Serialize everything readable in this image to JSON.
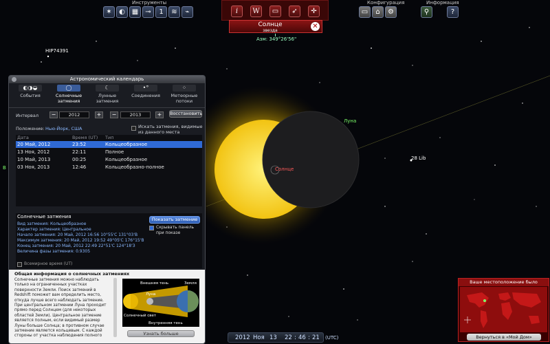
{
  "toolbar": {
    "tools_label": "Инструменты",
    "config_label": "Конфигурация",
    "info_label": "Информация",
    "tool_icons": [
      "constellation-icon",
      "planet-icon",
      "calendar-icon",
      "telescope-icon",
      "number-icon",
      "stats-icon",
      "satellite-icon"
    ],
    "center_icons": [
      {
        "name": "info-icon",
        "glyph": "i"
      },
      {
        "name": "wikipedia-icon",
        "glyph": "W"
      },
      {
        "name": "book-icon",
        "glyph": "▭"
      },
      {
        "name": "rocket-icon",
        "glyph": "➶"
      },
      {
        "name": "crosshair-icon",
        "glyph": "✛"
      }
    ],
    "config_icons": [
      "display-icon",
      "location-icon",
      "gear-icon"
    ],
    "help_icons": [
      {
        "name": "magnifier-icon",
        "glyph": "⚲"
      },
      {
        "name": "help-icon",
        "glyph": "?"
      }
    ]
  },
  "object_info": {
    "name": "Солнце",
    "type": "звезда",
    "azimuth": "Азм: 349°26'56\""
  },
  "sky_labels": {
    "star": "HIP74391",
    "moon": "Луна",
    "sun": "Солнце",
    "lib": "28 Lib",
    "edge": "B"
  },
  "calendar": {
    "title": "Астрономический календарь",
    "tabs": [
      {
        "label": "События",
        "active": false
      },
      {
        "label": "Солнечные затмения",
        "active": true
      },
      {
        "label": "Лунные затмения",
        "active": false
      },
      {
        "label": "Соединения",
        "active": false
      },
      {
        "label": "Метеорные потоки",
        "active": false
      }
    ],
    "interval_label": "Интервал",
    "year_from": "2012",
    "year_to": "2013",
    "restore_button": "Восстановить",
    "location_label": "Положение:",
    "location_value": "Нью-Йорк, США",
    "visible_only_label": "Искать затмения, видимые из данного места",
    "columns": [
      "Дата",
      "Время (UT)",
      "Тип"
    ],
    "rows": [
      {
        "date": "20 Май, 2012",
        "time": "23:52",
        "type": "Кольцеобразное",
        "selected": true
      },
      {
        "date": "13 Ноя, 2012",
        "time": "22:11",
        "type": "Полное",
        "selected": false
      },
      {
        "date": "10 Май, 2013",
        "time": "00:25",
        "type": "Кольцеобразное",
        "selected": false
      },
      {
        "date": "03 Ноя, 2013",
        "time": "12:46",
        "type": "Кольцеобразно-полное",
        "selected": false
      }
    ],
    "details_title": "Солнечные затмения",
    "show_button": "Показать затмение",
    "hide_panel_label": "Скрывать панель при показе",
    "hide_panel_checked": true,
    "details": [
      "Вид затмения: Кольцеобразное",
      "Характер затмения: Центральное",
      "Начало затмения: 20 Май, 2012 16:56 10°55'С 131°03'В",
      "Максимум затмения: 20 Май, 2012 19:52 49°05'С 176°15'В",
      "Конец затмения: 20 Май, 2012 22:49 22°51'С 124°18'З",
      "Величина фазы затмения: 0.9305"
    ],
    "universal_time_label": "Всемирное время (UT)",
    "general_title": "Общая информация о солнечных затмениях",
    "general_text": "Солнечные затмения можно наблюдать только на ограниченных участках поверхности Земли. Поиск затмений в Redshift поможет вам определить место, откуда лучше всего наблюдать затмение. При центральном затмении Луна проходит прямо перед Солнцем (для некоторых областей Земли). Центральное затмение является полным, если видимый размер Луны больше Солнца; в противном случае затмение является кольцевым. С каждой стороны от участка наблюдения полного",
    "diagram_labels": {
      "outer_shadow": "Внешняя тень",
      "earth": "Земля",
      "moon": "Луна",
      "sunlight": "Солнечный свет",
      "inner_shadow": "Внутренняя тень"
    },
    "more_button": "Узнать больше"
  },
  "time": {
    "year": "2012",
    "month": "Ноя",
    "day": "13",
    "hour": "22",
    "minute": "46",
    "second": "21",
    "zone": "(UTC)"
  },
  "map": {
    "title": "Ваше местоположение было изменено",
    "home_button": "Вернуться в «Мой Дом»"
  },
  "colors": {
    "sun": "#f5cf12",
    "moon": "#1d1d1f",
    "selection": "#2f6ad6",
    "moon_label": "#7dff6a",
    "sun_label": "#ff5a5a"
  }
}
